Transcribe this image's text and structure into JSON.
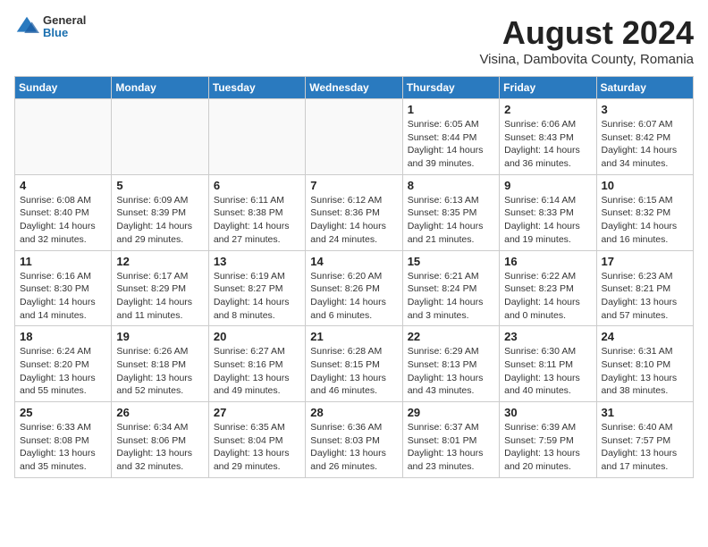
{
  "header": {
    "logo_general": "General",
    "logo_blue": "Blue",
    "title": "August 2024",
    "subtitle": "Visina, Dambovita County, Romania"
  },
  "calendar": {
    "weekdays": [
      "Sunday",
      "Monday",
      "Tuesday",
      "Wednesday",
      "Thursday",
      "Friday",
      "Saturday"
    ],
    "weeks": [
      [
        {
          "day": "",
          "info": ""
        },
        {
          "day": "",
          "info": ""
        },
        {
          "day": "",
          "info": ""
        },
        {
          "day": "",
          "info": ""
        },
        {
          "day": "1",
          "info": "Sunrise: 6:05 AM\nSunset: 8:44 PM\nDaylight: 14 hours and 39 minutes."
        },
        {
          "day": "2",
          "info": "Sunrise: 6:06 AM\nSunset: 8:43 PM\nDaylight: 14 hours and 36 minutes."
        },
        {
          "day": "3",
          "info": "Sunrise: 6:07 AM\nSunset: 8:42 PM\nDaylight: 14 hours and 34 minutes."
        }
      ],
      [
        {
          "day": "4",
          "info": "Sunrise: 6:08 AM\nSunset: 8:40 PM\nDaylight: 14 hours and 32 minutes."
        },
        {
          "day": "5",
          "info": "Sunrise: 6:09 AM\nSunset: 8:39 PM\nDaylight: 14 hours and 29 minutes."
        },
        {
          "day": "6",
          "info": "Sunrise: 6:11 AM\nSunset: 8:38 PM\nDaylight: 14 hours and 27 minutes."
        },
        {
          "day": "7",
          "info": "Sunrise: 6:12 AM\nSunset: 8:36 PM\nDaylight: 14 hours and 24 minutes."
        },
        {
          "day": "8",
          "info": "Sunrise: 6:13 AM\nSunset: 8:35 PM\nDaylight: 14 hours and 21 minutes."
        },
        {
          "day": "9",
          "info": "Sunrise: 6:14 AM\nSunset: 8:33 PM\nDaylight: 14 hours and 19 minutes."
        },
        {
          "day": "10",
          "info": "Sunrise: 6:15 AM\nSunset: 8:32 PM\nDaylight: 14 hours and 16 minutes."
        }
      ],
      [
        {
          "day": "11",
          "info": "Sunrise: 6:16 AM\nSunset: 8:30 PM\nDaylight: 14 hours and 14 minutes."
        },
        {
          "day": "12",
          "info": "Sunrise: 6:17 AM\nSunset: 8:29 PM\nDaylight: 14 hours and 11 minutes."
        },
        {
          "day": "13",
          "info": "Sunrise: 6:19 AM\nSunset: 8:27 PM\nDaylight: 14 hours and 8 minutes."
        },
        {
          "day": "14",
          "info": "Sunrise: 6:20 AM\nSunset: 8:26 PM\nDaylight: 14 hours and 6 minutes."
        },
        {
          "day": "15",
          "info": "Sunrise: 6:21 AM\nSunset: 8:24 PM\nDaylight: 14 hours and 3 minutes."
        },
        {
          "day": "16",
          "info": "Sunrise: 6:22 AM\nSunset: 8:23 PM\nDaylight: 14 hours and 0 minutes."
        },
        {
          "day": "17",
          "info": "Sunrise: 6:23 AM\nSunset: 8:21 PM\nDaylight: 13 hours and 57 minutes."
        }
      ],
      [
        {
          "day": "18",
          "info": "Sunrise: 6:24 AM\nSunset: 8:20 PM\nDaylight: 13 hours and 55 minutes."
        },
        {
          "day": "19",
          "info": "Sunrise: 6:26 AM\nSunset: 8:18 PM\nDaylight: 13 hours and 52 minutes."
        },
        {
          "day": "20",
          "info": "Sunrise: 6:27 AM\nSunset: 8:16 PM\nDaylight: 13 hours and 49 minutes."
        },
        {
          "day": "21",
          "info": "Sunrise: 6:28 AM\nSunset: 8:15 PM\nDaylight: 13 hours and 46 minutes."
        },
        {
          "day": "22",
          "info": "Sunrise: 6:29 AM\nSunset: 8:13 PM\nDaylight: 13 hours and 43 minutes."
        },
        {
          "day": "23",
          "info": "Sunrise: 6:30 AM\nSunset: 8:11 PM\nDaylight: 13 hours and 40 minutes."
        },
        {
          "day": "24",
          "info": "Sunrise: 6:31 AM\nSunset: 8:10 PM\nDaylight: 13 hours and 38 minutes."
        }
      ],
      [
        {
          "day": "25",
          "info": "Sunrise: 6:33 AM\nSunset: 8:08 PM\nDaylight: 13 hours and 35 minutes."
        },
        {
          "day": "26",
          "info": "Sunrise: 6:34 AM\nSunset: 8:06 PM\nDaylight: 13 hours and 32 minutes."
        },
        {
          "day": "27",
          "info": "Sunrise: 6:35 AM\nSunset: 8:04 PM\nDaylight: 13 hours and 29 minutes."
        },
        {
          "day": "28",
          "info": "Sunrise: 6:36 AM\nSunset: 8:03 PM\nDaylight: 13 hours and 26 minutes."
        },
        {
          "day": "29",
          "info": "Sunrise: 6:37 AM\nSunset: 8:01 PM\nDaylight: 13 hours and 23 minutes."
        },
        {
          "day": "30",
          "info": "Sunrise: 6:39 AM\nSunset: 7:59 PM\nDaylight: 13 hours and 20 minutes."
        },
        {
          "day": "31",
          "info": "Sunrise: 6:40 AM\nSunset: 7:57 PM\nDaylight: 13 hours and 17 minutes."
        }
      ]
    ]
  }
}
